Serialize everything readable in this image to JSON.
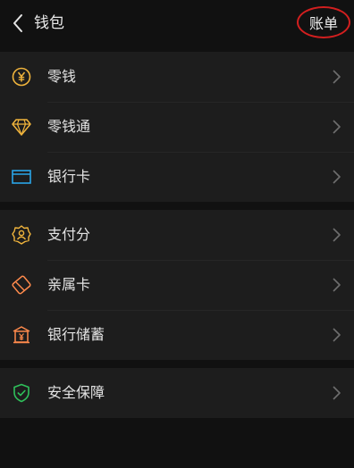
{
  "header": {
    "title": "钱包",
    "bill_label": "账单"
  },
  "groups": [
    {
      "items": [
        {
          "label": "零钱",
          "icon": "yuan-coin-icon",
          "color": "#f0b43c"
        },
        {
          "label": "零钱通",
          "icon": "diamond-icon",
          "color": "#f0b43c"
        },
        {
          "label": "银行卡",
          "icon": "bank-card-icon",
          "color": "#2aa5e8"
        }
      ]
    },
    {
      "items": [
        {
          "label": "支付分",
          "icon": "credit-score-icon",
          "color": "#f0b43c"
        },
        {
          "label": "亲属卡",
          "icon": "family-card-icon",
          "color": "#ff8a4c"
        },
        {
          "label": "银行储蓄",
          "icon": "savings-bank-icon",
          "color": "#ff8a4c"
        }
      ]
    },
    {
      "items": [
        {
          "label": "安全保障",
          "icon": "shield-check-icon",
          "color": "#2fc05a"
        }
      ]
    }
  ],
  "colors": {
    "background": "#111111",
    "row_background": "#1d1d1d",
    "highlight_ring": "#d21f1f",
    "chevron": "#6e6e6e"
  }
}
